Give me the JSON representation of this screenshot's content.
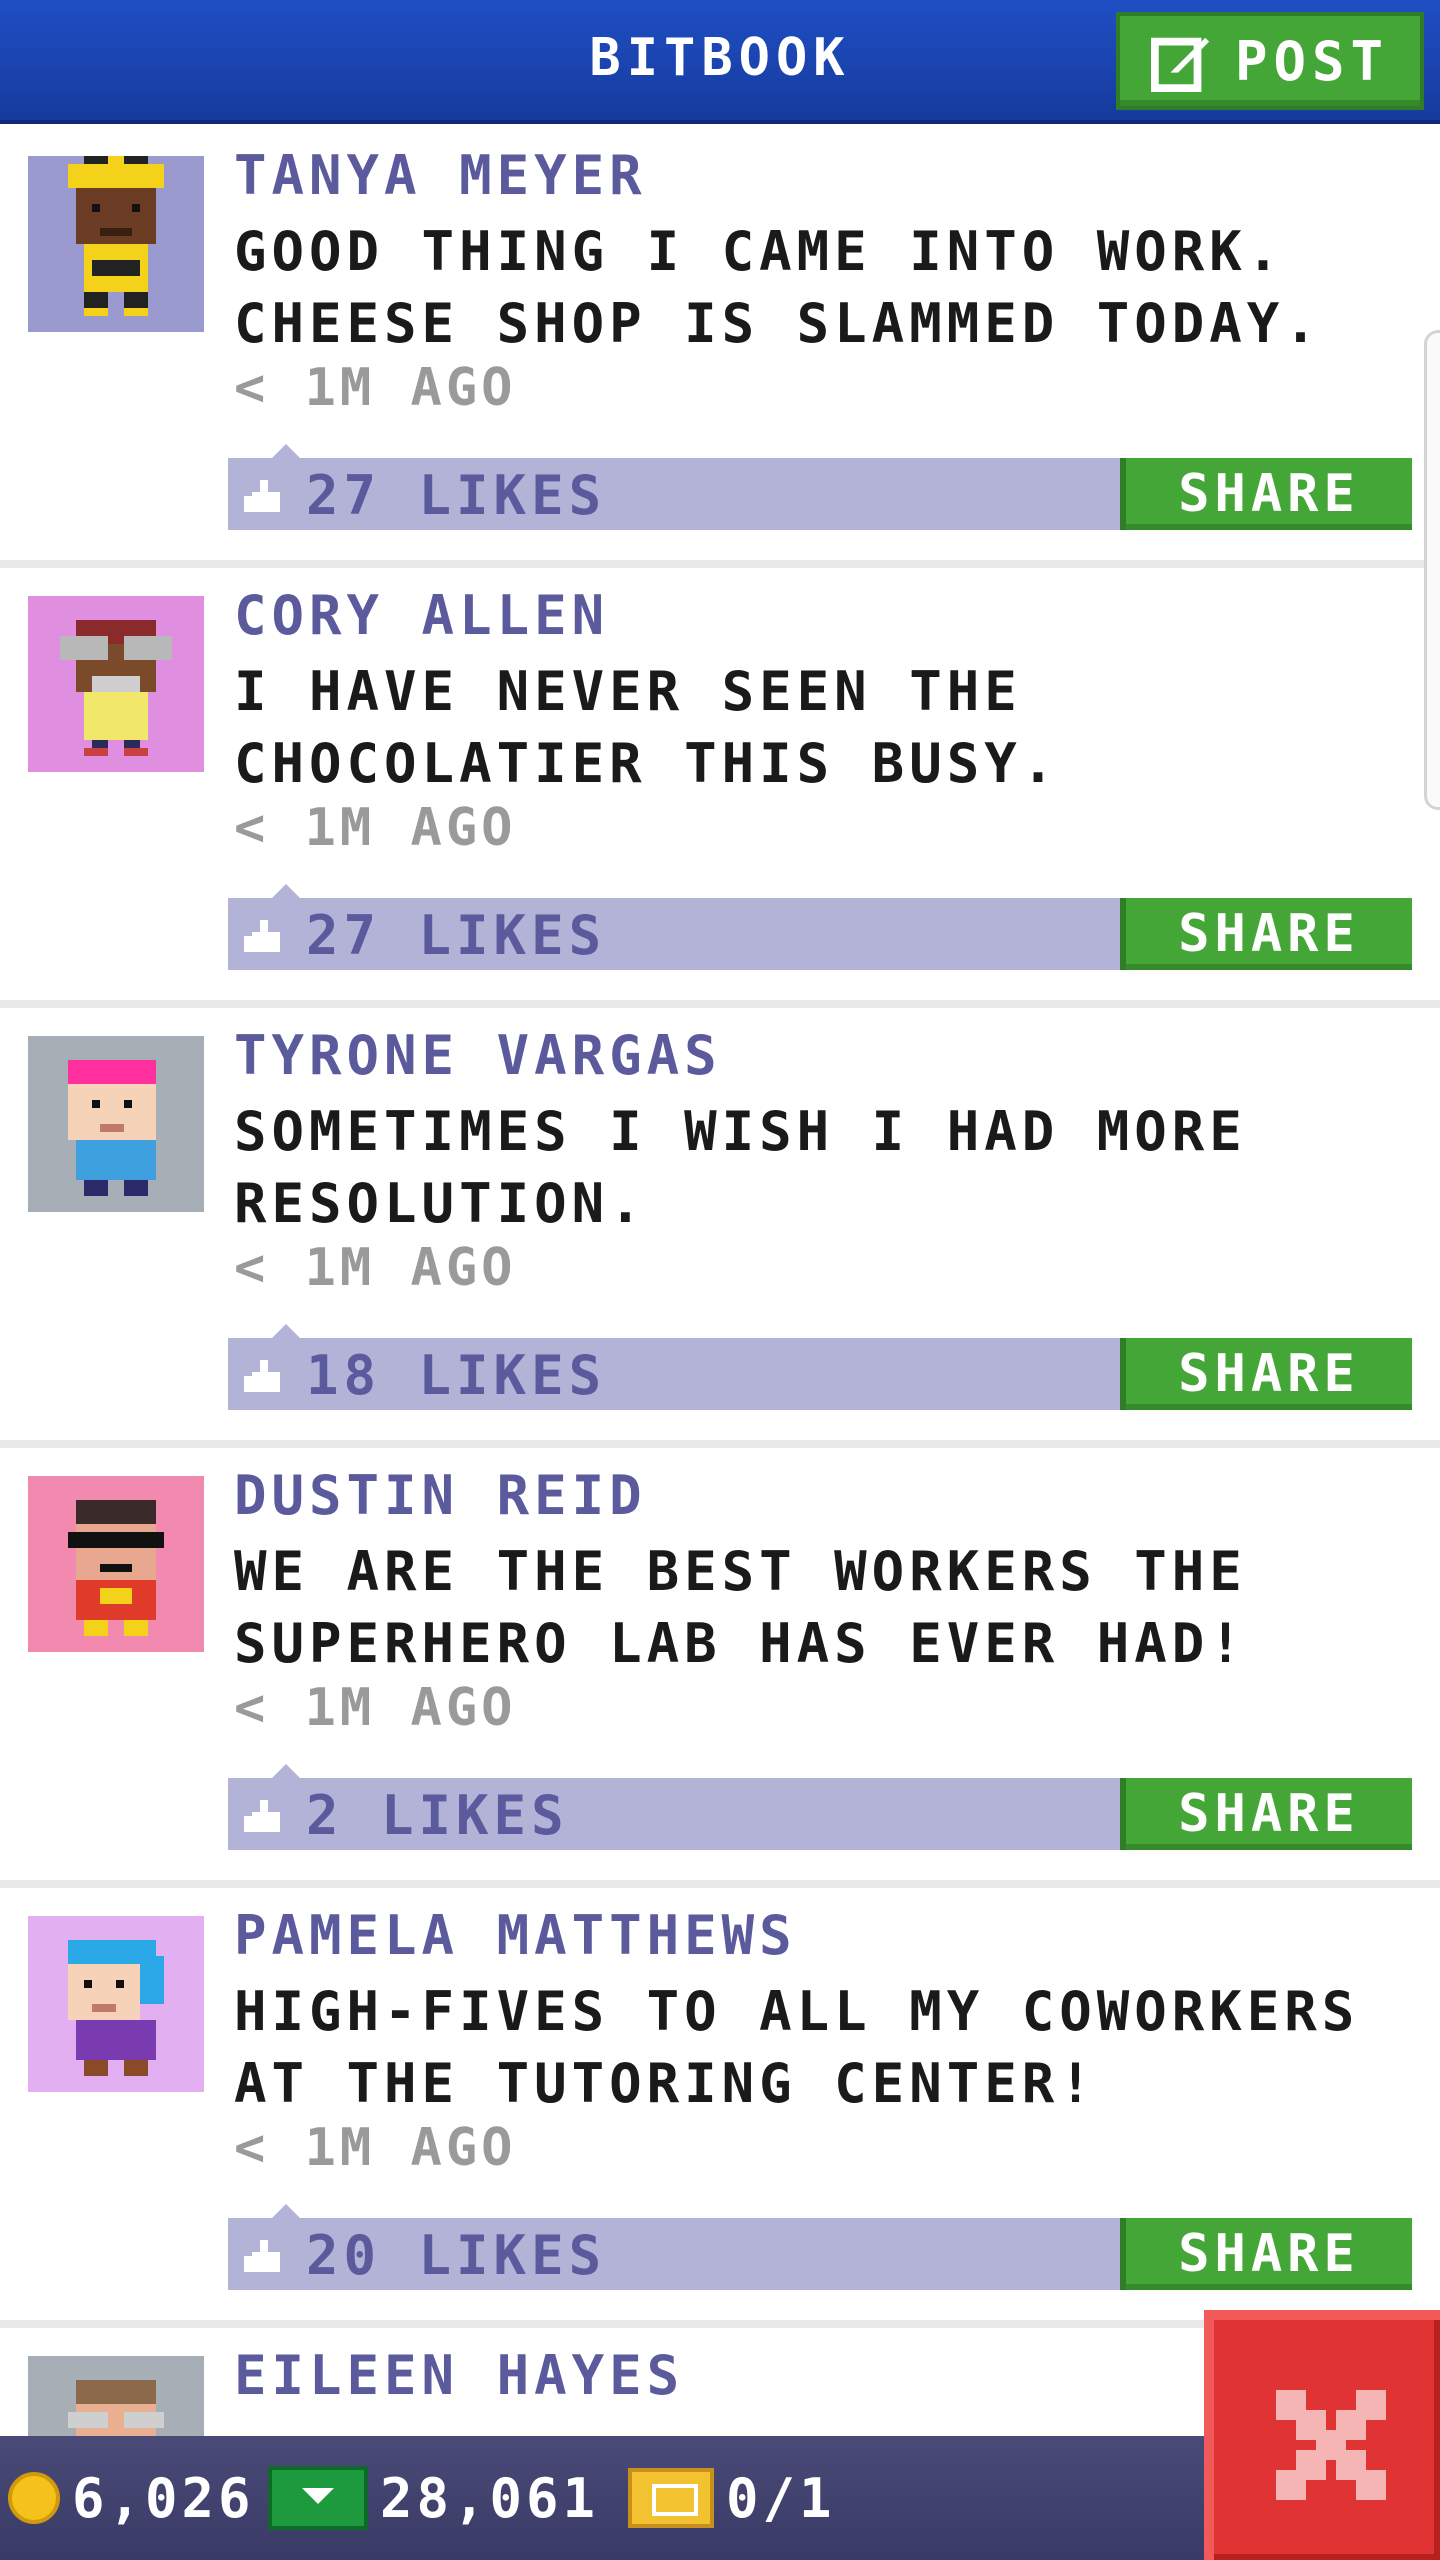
{
  "header": {
    "title": "BITBOOK",
    "post_label": "POST",
    "post_icon": "edit-icon"
  },
  "posts": [
    {
      "author": "TANYA MEYER",
      "message": "GOOD THING I CAME INTO WORK. CHEESE SHOP IS SLAMMED TODAY.",
      "time": "< 1M AGO",
      "likes": "27 LIKES",
      "share_label": "SHARE",
      "avatar_bg": "#9a9ad0"
    },
    {
      "author": "CORY ALLEN",
      "message": "I HAVE NEVER SEEN THE CHOCOLATIER THIS BUSY.",
      "time": "< 1M AGO",
      "likes": "27 LIKES",
      "share_label": "SHARE",
      "avatar_bg": "#e08ee0"
    },
    {
      "author": "TYRONE VARGAS",
      "message": "SOMETIMES I WISH I HAD MORE RESOLUTION.",
      "time": "< 1M AGO",
      "likes": "18 LIKES",
      "share_label": "SHARE",
      "avatar_bg": "#a8aeb6"
    },
    {
      "author": "DUSTIN REID",
      "message": "WE ARE THE BEST WORKERS THE SUPERHERO LAB HAS EVER HAD!",
      "time": "< 1M AGO",
      "likes": "2 LIKES",
      "share_label": "SHARE",
      "avatar_bg": "#f28ab0"
    },
    {
      "author": "PAMELA MATTHEWS",
      "message": "HIGH-FIVES TO ALL MY COWORKERS AT THE TUTORING CENTER!",
      "time": "< 1M AGO",
      "likes": "20 LIKES",
      "share_label": "SHARE",
      "avatar_bg": "#e2b0f0"
    }
  ],
  "partial_post": {
    "author": "EILEEN HAYES",
    "avatar_bg": "#a8aeb6"
  },
  "bottom_bar": {
    "coins": "6,026",
    "bux": "28,061",
    "tickets": "0/1"
  },
  "close_icon": "close-icon",
  "colors": {
    "header_blue": "#1f4fc4",
    "share_green": "#44a637",
    "like_bar": "#b3b3d8",
    "name_purple": "#5b5a9c",
    "close_red": "#e03434"
  }
}
